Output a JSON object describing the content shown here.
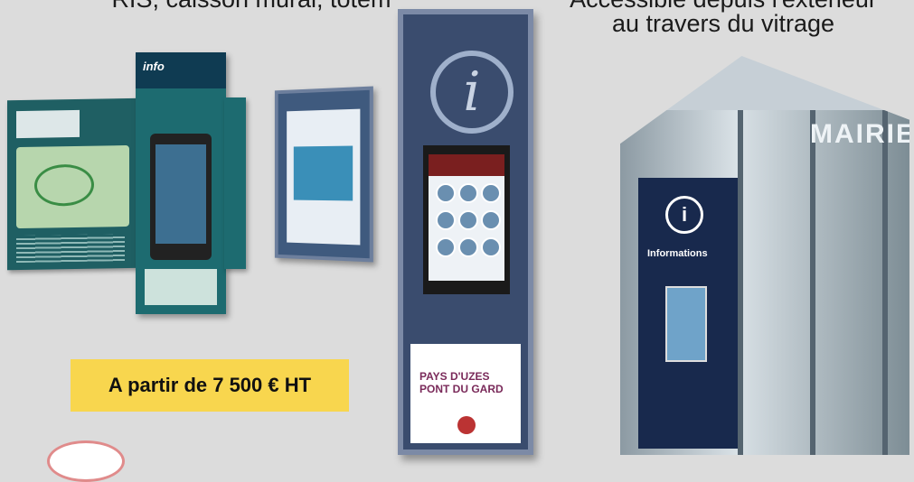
{
  "captions": {
    "left": "RIS, caisson mural, totem",
    "right_line1": "Accessible depuis l'extérieur",
    "right_line2": "au travers du vitrage"
  },
  "price_label": "A partir de 7 500 € HT",
  "totem_ad_text": "PAYS D'UZES PONT DU GARD",
  "kiosk": {
    "sign": "MAIRIE",
    "info_label": "Informations"
  },
  "info_panel_logo": "info"
}
